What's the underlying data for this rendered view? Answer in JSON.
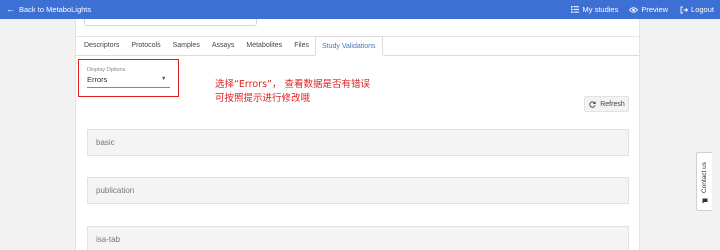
{
  "header": {
    "back_label": "Back to MetaboLights",
    "my_studies": "My studies",
    "preview": "Preview",
    "logout": "Logout"
  },
  "tabs": [
    {
      "label": "Descriptors",
      "active": false
    },
    {
      "label": "Protocols",
      "active": false
    },
    {
      "label": "Samples",
      "active": false
    },
    {
      "label": "Assays",
      "active": false
    },
    {
      "label": "Metabolites",
      "active": false
    },
    {
      "label": "Files",
      "active": false
    },
    {
      "label": "Study Validations",
      "active": true
    }
  ],
  "display_options": {
    "label": "Display Options",
    "selected": "Errors"
  },
  "annotation": {
    "line1": "选择“Errors”， 查看数据是否有错误",
    "line2": "可按照提示进行修改哦"
  },
  "refresh_label": "Refresh",
  "sections": [
    {
      "label": "basic"
    },
    {
      "label": "publication"
    },
    {
      "label": "isa-tab"
    }
  ],
  "contact_label": "Contact us",
  "colors": {
    "header_bg": "#3c70d4",
    "active_tab": "#4a76c4",
    "highlight": "#e02020"
  }
}
